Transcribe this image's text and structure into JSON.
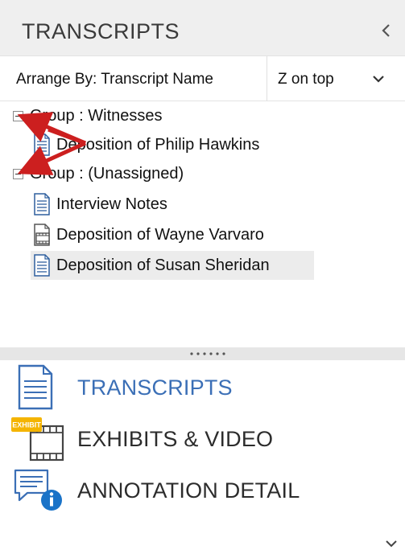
{
  "header": {
    "title": "TRANSCRIPTS"
  },
  "arrange": {
    "label": "Arrange By: Transcript Name",
    "sort_value": "Z on top"
  },
  "tree": {
    "groups": [
      {
        "label": "Group : Witnesses",
        "items": [
          "Deposition of Philip Hawkins"
        ]
      },
      {
        "label": "Group : (Unassigned)",
        "items": [
          "Interview Notes",
          "Deposition of Wayne Varvaro",
          "Deposition of Susan Sheridan"
        ]
      }
    ]
  },
  "nav": {
    "transcripts": "TRANSCRIPTS",
    "exhibits": "EXHIBITS & VIDEO",
    "exhibit_badge": "EXHIBIT",
    "annotation": "ANNOTATION DETAIL"
  },
  "colors": {
    "accent": "#3b6fb6",
    "arrow": "#cc1f1f",
    "badge": "#f4b400",
    "info": "#1a73c8"
  }
}
